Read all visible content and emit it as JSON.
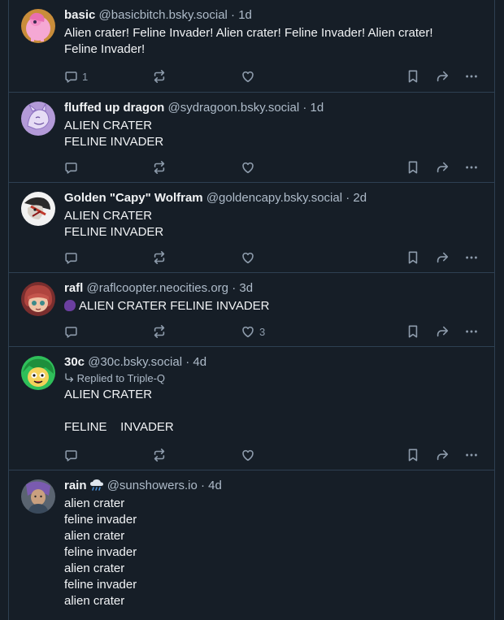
{
  "posts": [
    {
      "name": "basic",
      "handle": "@basicbitch.bsky.social",
      "sep": "·",
      "time": "1d",
      "lines": [
        "Alien crater! Feline Invader! Alien crater! Feline Invader! Alien crater!",
        "Feline Invader!"
      ],
      "reply_count": "1",
      "like_count": ""
    },
    {
      "name": "fluffed up dragon",
      "handle": "@sydragoon.bsky.social",
      "sep": "·",
      "time": "1d",
      "lines": [
        "ALIEN CRATER",
        "FELINE INVADER"
      ],
      "reply_count": "",
      "like_count": ""
    },
    {
      "name": "Golden \"Capy\" Wolfram",
      "handle": "@goldencapy.bsky.social",
      "sep": "·",
      "time": "2d",
      "lines": [
        "ALIEN CRATER",
        "FELINE INVADER"
      ],
      "reply_count": "",
      "like_count": ""
    },
    {
      "name": "rafl",
      "handle": "@raflcoopter.neocities.org",
      "sep": "·",
      "time": "3d",
      "lines": [
        "ALIEN CRATER FELINE INVADER"
      ],
      "reply_count": "",
      "like_count": "3"
    },
    {
      "name": "30c",
      "handle": "@30c.bsky.social",
      "sep": "·",
      "time": "4d",
      "reply_to": "Replied to Triple-Q",
      "lines": [
        "ALIEN CRATER",
        "",
        "FELINE    INVADER"
      ],
      "reply_count": "",
      "like_count": ""
    },
    {
      "name": "rain",
      "handle": "@sunshowers.io",
      "sep": "·",
      "time": "4d",
      "lines": [
        "alien crater",
        "feline invader",
        "alien crater",
        "feline invader",
        "alien crater",
        "feline invader",
        "alien crater"
      ],
      "reply_count": "",
      "like_count": ""
    }
  ],
  "icons": {
    "reply": "speech-bubble-icon",
    "repost": "repost-arrows-icon",
    "like": "heart-icon",
    "bookmark": "bookmark-icon",
    "share": "share-arrow-icon",
    "more": "ellipsis-icon"
  },
  "colors": {
    "background": "#161e27",
    "border": "#2e4052",
    "text": "#f1f3f5",
    "muted": "#aebbc9"
  }
}
